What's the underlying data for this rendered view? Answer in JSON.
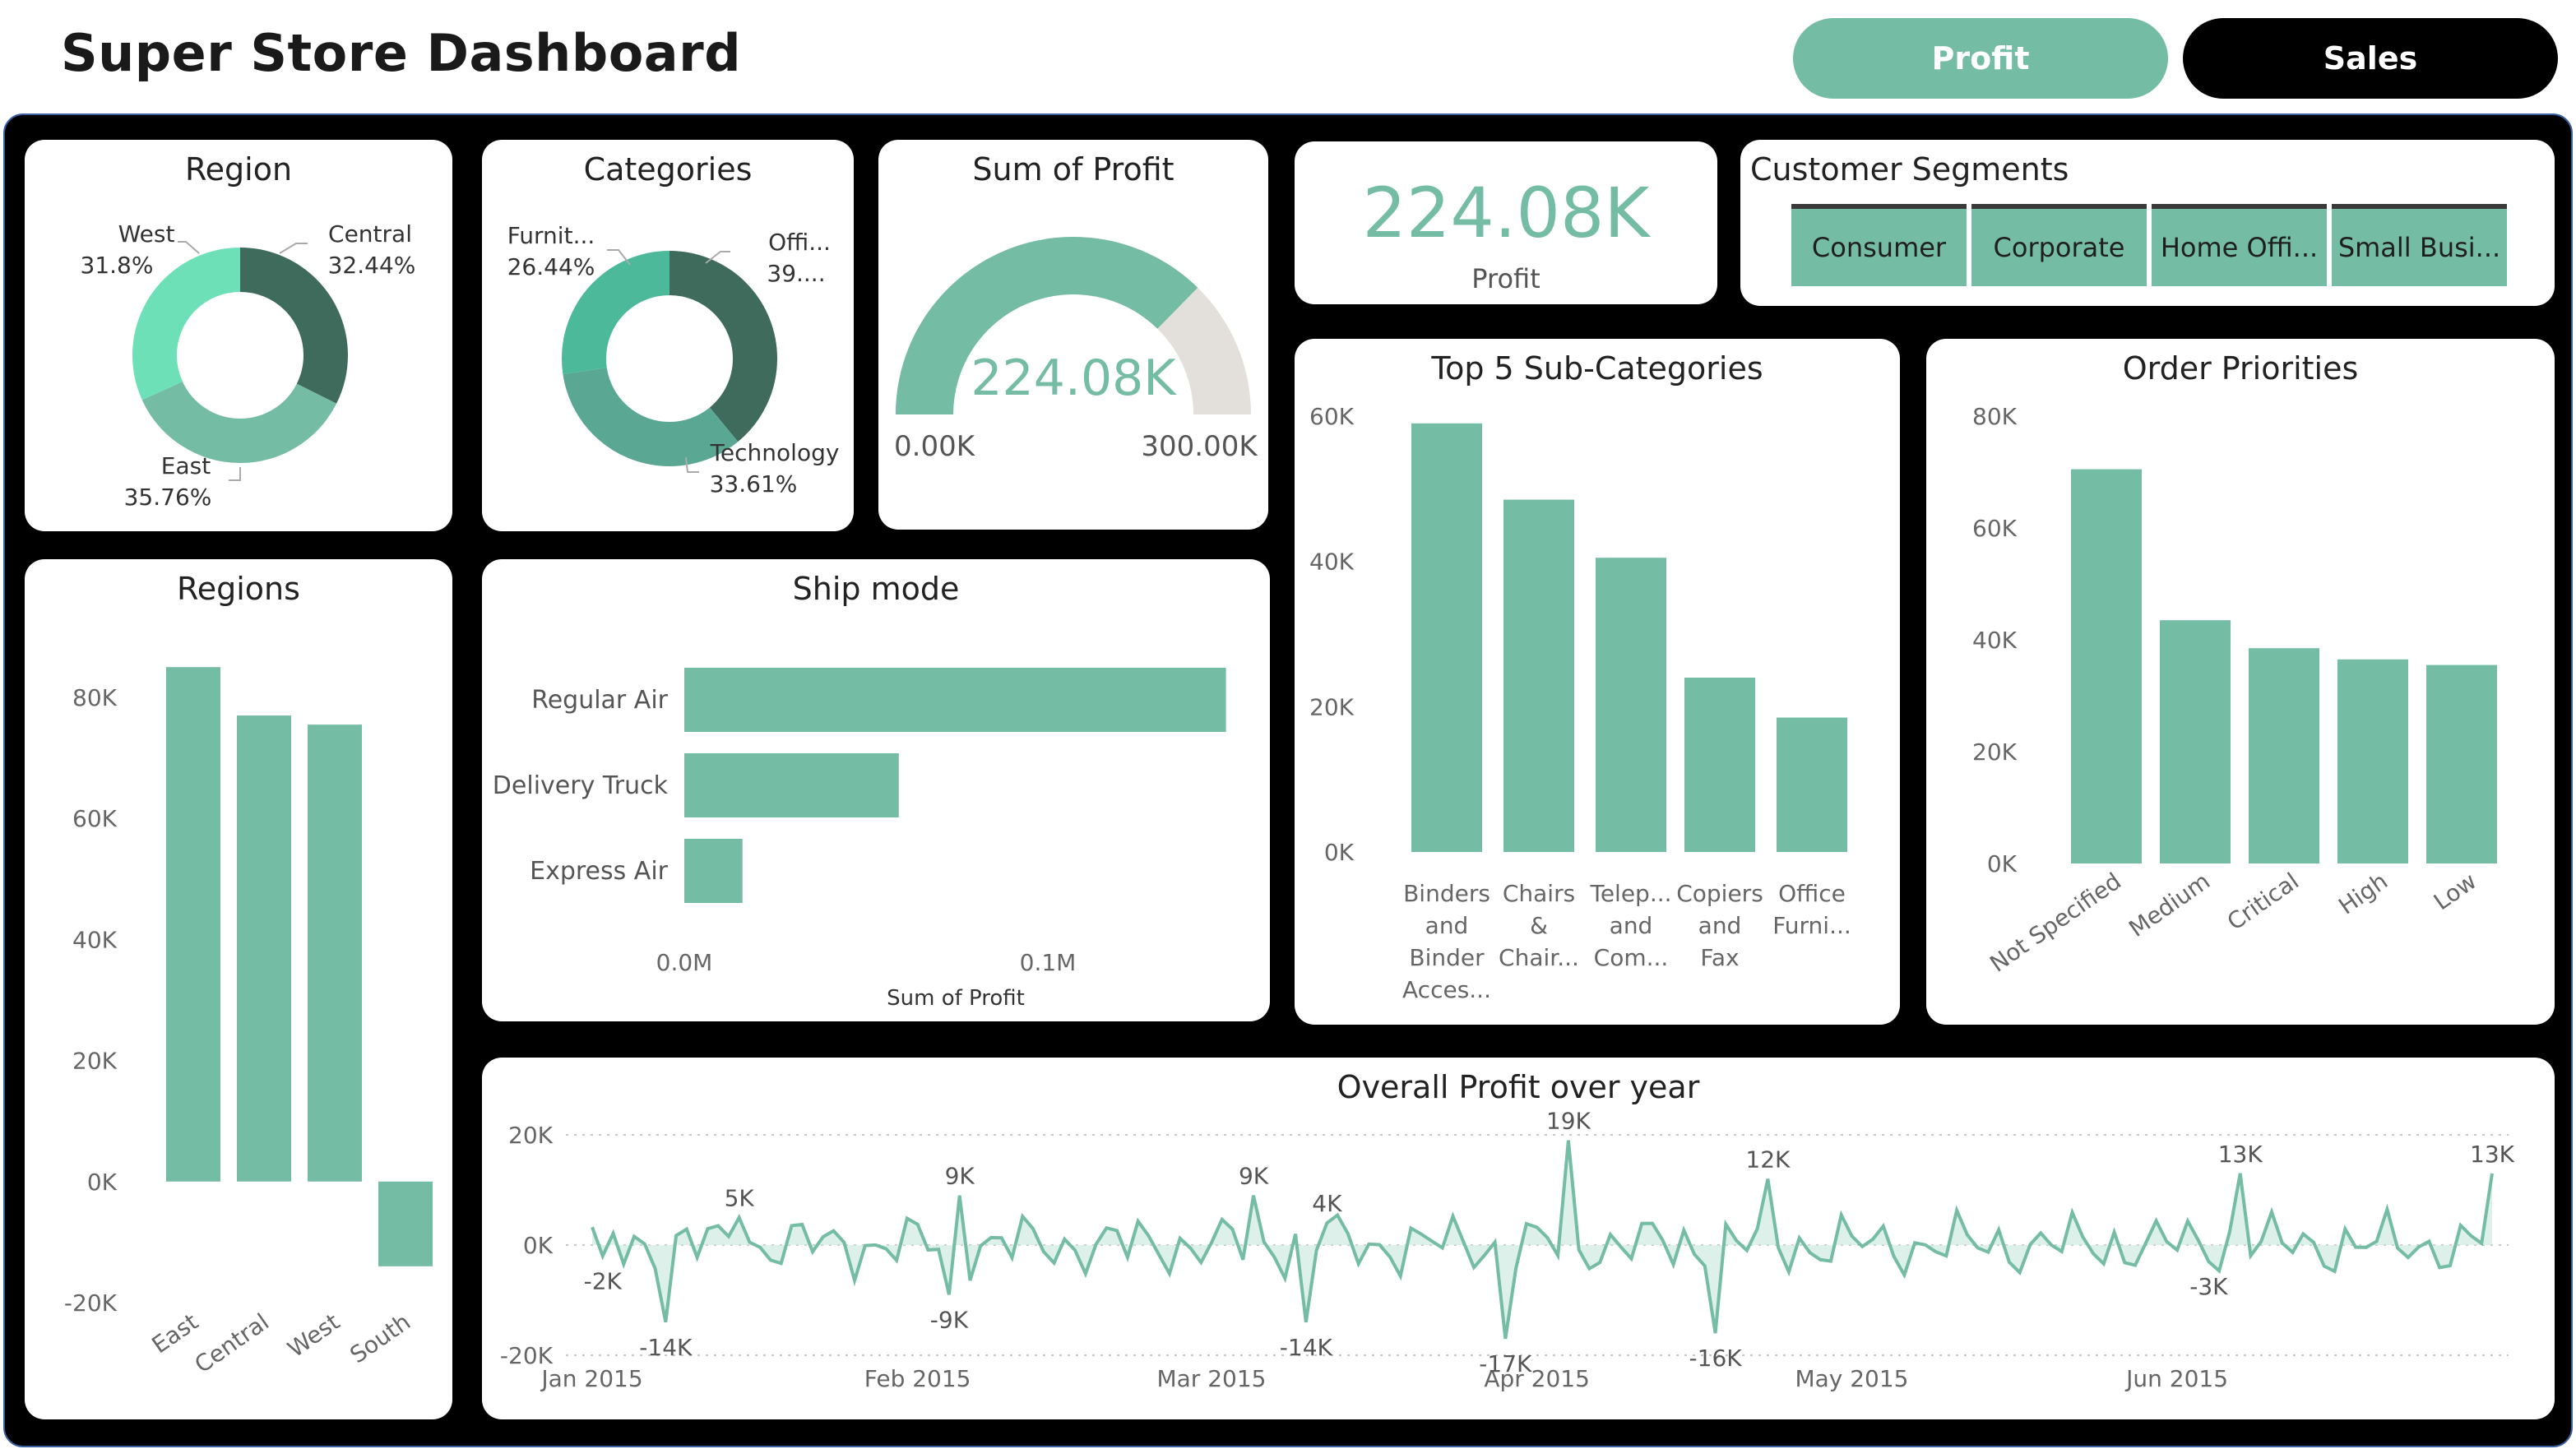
{
  "header": {
    "title": "Super Store Dashboard",
    "profit_button": "Profit",
    "sales_button": "Sales"
  },
  "colors": {
    "accent": "#74bca3",
    "dark": "#3f6b5c",
    "light": "#6ee0b8",
    "gauge_rest": "#e3e0dc"
  },
  "region_donut": {
    "title": "Region",
    "labels": [
      {
        "name": "West",
        "pct": "31.8%"
      },
      {
        "name": "Central",
        "pct": "32.44%"
      },
      {
        "name": "East",
        "pct": "35.76%"
      }
    ]
  },
  "categories_donut": {
    "title": "Categories",
    "labels": [
      {
        "name": "Furnit...",
        "pct": "26.44%"
      },
      {
        "name": "Offi...",
        "pct": "39...."
      },
      {
        "name": "Technology",
        "pct": "33.61%"
      }
    ]
  },
  "gauge": {
    "title": "Sum of Profit",
    "value_text": "224.08K",
    "min_text": "0.00K",
    "max_text": "300.00K",
    "value": 224.08,
    "max": 300
  },
  "kpi": {
    "value": "224.08K",
    "label": "Profit"
  },
  "segments": {
    "title": "Customer Segments",
    "items": [
      "Consumer",
      "Corporate",
      "Home Offi...",
      "Small Busi..."
    ]
  },
  "chart_data": [
    {
      "id": "regions",
      "type": "bar",
      "title": "Regions",
      "categories": [
        "East",
        "Central",
        "West",
        "South"
      ],
      "values": [
        85000,
        77000,
        75500,
        -14000
      ],
      "ylim": [
        -20000,
        90000
      ],
      "yticks": [
        "80K",
        "60K",
        "40K",
        "20K",
        "0K",
        "-20K"
      ],
      "ytick_values": [
        80000,
        60000,
        40000,
        20000,
        0,
        -20000
      ]
    },
    {
      "id": "ship_mode",
      "type": "bar",
      "title": "Ship mode",
      "categories": [
        "Regular Air",
        "Delivery Truck",
        "Express Air"
      ],
      "values": [
        0.149,
        0.059,
        0.016
      ],
      "xticks": [
        "0.0M",
        "0.1M"
      ],
      "xtick_values": [
        0,
        0.1
      ],
      "xlim": [
        0,
        0.15
      ],
      "xlabel": "Sum of Profit"
    },
    {
      "id": "top5",
      "type": "bar",
      "title": "Top 5 Sub-Categories",
      "categories": [
        [
          "Binders",
          "and",
          "Binder",
          "Acces..."
        ],
        [
          "Chairs",
          "&",
          "Chair..."
        ],
        [
          "Telep...",
          "and",
          "Com..."
        ],
        [
          "Copiers",
          "and",
          "Fax"
        ],
        [
          "Office",
          "Furni..."
        ]
      ],
      "values": [
        59000,
        48500,
        40500,
        24000,
        18500
      ],
      "ylim": [
        0,
        60000
      ],
      "yticks": [
        "60K",
        "40K",
        "20K",
        "0K"
      ],
      "ytick_values": [
        60000,
        40000,
        20000,
        0
      ]
    },
    {
      "id": "priorities",
      "type": "bar",
      "title": "Order Priorities",
      "categories": [
        "Not Specified",
        "Medium",
        "Critical",
        "High",
        "Low"
      ],
      "values": [
        70500,
        43500,
        38500,
        36500,
        35500
      ],
      "ylim": [
        0,
        80000
      ],
      "yticks": [
        "80K",
        "60K",
        "40K",
        "20K",
        "0K"
      ],
      "ytick_values": [
        80000,
        60000,
        40000,
        20000,
        0
      ]
    },
    {
      "id": "overall",
      "type": "area",
      "title": "Overall Profit over year",
      "ylim": [
        -20000,
        20000
      ],
      "yticks": [
        "20K",
        "0K",
        "-20K"
      ],
      "ytick_values": [
        20000,
        0,
        -20000
      ],
      "xticks": [
        "Jan 2015",
        "Feb 2015",
        "Mar 2015",
        "Apr 2015",
        "May 2015",
        "Jun 2015"
      ],
      "xtick_days": [
        0,
        31,
        59,
        90,
        120,
        151
      ],
      "annotations": [
        {
          "day": 1,
          "y": -2000,
          "label": "-2K"
        },
        {
          "day": 7,
          "y": -14000,
          "label": "-14K"
        },
        {
          "day": 14,
          "y": 5000,
          "label": "5K"
        },
        {
          "day": 34,
          "y": -9000,
          "label": "-9K"
        },
        {
          "day": 35,
          "y": 9000,
          "label": "9K"
        },
        {
          "day": 63,
          "y": 9000,
          "label": "9K"
        },
        {
          "day": 68,
          "y": -14000,
          "label": "-14K"
        },
        {
          "day": 70,
          "y": 4000,
          "label": "4K"
        },
        {
          "day": 87,
          "y": -17000,
          "label": "-17K"
        },
        {
          "day": 93,
          "y": 19000,
          "label": "19K"
        },
        {
          "day": 107,
          "y": -16000,
          "label": "-16K"
        },
        {
          "day": 112,
          "y": 12000,
          "label": "12K"
        },
        {
          "day": 154,
          "y": -3000,
          "label": "-3K"
        },
        {
          "day": 157,
          "y": 13000,
          "label": "13K"
        },
        {
          "day": 181,
          "y": 13000,
          "label": "13K"
        }
      ]
    }
  ]
}
